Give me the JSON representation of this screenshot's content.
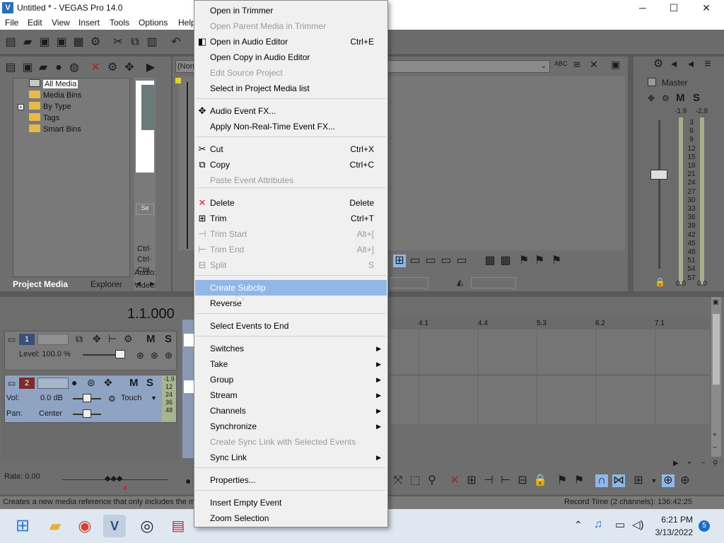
{
  "window": {
    "title": "Untitled * - VEGAS Pro 14.0",
    "min": "─",
    "max": "☐",
    "close": "✕"
  },
  "menu": [
    "File",
    "Edit",
    "View",
    "Insert",
    "Tools",
    "Options",
    "Help"
  ],
  "project_media": {
    "tree": [
      "All Media",
      "Media Bins",
      "By Type",
      "Tags",
      "Smart Bins"
    ],
    "tabs": [
      "Project Media",
      "Explorer"
    ],
    "side_labels": [
      "Ctrl·",
      "Ctrl·",
      "Ctrl·",
      "Video:",
      "Audio:"
    ]
  },
  "trimmer": {
    "preview_combo": "(Non"
  },
  "master": {
    "title": "Master",
    "m": "M",
    "s": "S",
    "db_left": "-1.9",
    "db_right": "-2.8",
    "scale": [
      "3",
      "6",
      "9",
      "12",
      "15",
      "18",
      "21",
      "24",
      "27",
      "30",
      "33",
      "36",
      "39",
      "42",
      "45",
      "48",
      "51",
      "54",
      "57"
    ],
    "bottom_left": "0.0",
    "bottom_right": "0.0"
  },
  "timeline": {
    "time": "1.1.000",
    "ruler": [
      "4.1",
      "4.4",
      "5.3",
      "6.2",
      "7.1"
    ],
    "rate": "Rate: 0.00"
  },
  "tracks": [
    {
      "num": "1",
      "level": "Level: 100.0 %",
      "m": "M",
      "s": "S"
    },
    {
      "num": "2",
      "vol_label": "Vol:",
      "vol_value": "0.0 dB",
      "pan_label": "Pan:",
      "pan_value": "Center",
      "touch": "Touch",
      "m": "M",
      "s": "S",
      "meter": [
        "-1.9",
        "12",
        "24",
        "36",
        "48"
      ]
    }
  ],
  "status": {
    "hint": "Creates a new media reference that only includes the me",
    "record_time": "Record Time (2 channels): 136:42:25"
  },
  "taskbar": {
    "time": "6:21 PM",
    "date": "3/13/2022",
    "badge": "5"
  },
  "context_menu": [
    {
      "label": "Open in Trimmer",
      "shortcut": "",
      "disabled": false
    },
    {
      "label": "Open Parent Media in Trimmer",
      "shortcut": "",
      "disabled": true
    },
    {
      "label": "Open in Audio Editor",
      "shortcut": "Ctrl+E",
      "disabled": false
    },
    {
      "label": "Open Copy in Audio Editor",
      "shortcut": "",
      "disabled": false
    },
    {
      "label": "Edit Source Project",
      "shortcut": "",
      "disabled": true
    },
    {
      "label": "Select in Project Media list",
      "shortcut": "",
      "disabled": false
    },
    {
      "label": "Audio Event FX...",
      "shortcut": "",
      "disabled": false
    },
    {
      "label": "Apply Non-Real-Time Event FX...",
      "shortcut": "",
      "disabled": false
    },
    {
      "label": "Cut",
      "shortcut": "Ctrl+X",
      "disabled": false
    },
    {
      "label": "Copy",
      "shortcut": "Ctrl+C",
      "disabled": false
    },
    {
      "label": "Paste Event Attributes",
      "shortcut": "",
      "disabled": true
    },
    {
      "label": "Delete",
      "shortcut": "Delete",
      "disabled": false
    },
    {
      "label": "Trim",
      "shortcut": "Ctrl+T",
      "disabled": false
    },
    {
      "label": "Trim Start",
      "shortcut": "Alt+[",
      "disabled": true
    },
    {
      "label": "Trim End",
      "shortcut": "Alt+]",
      "disabled": true
    },
    {
      "label": "Split",
      "shortcut": "S",
      "disabled": true
    },
    {
      "label": "Create Subclip",
      "shortcut": "",
      "disabled": false,
      "highlighted": true
    },
    {
      "label": "Reverse",
      "shortcut": "",
      "disabled": false
    },
    {
      "label": "Select Events to End",
      "shortcut": "",
      "disabled": false
    },
    {
      "label": "Switches",
      "shortcut": "",
      "disabled": false,
      "submenu": true
    },
    {
      "label": "Take",
      "shortcut": "",
      "disabled": false,
      "submenu": true
    },
    {
      "label": "Group",
      "shortcut": "",
      "disabled": false,
      "submenu": true
    },
    {
      "label": "Stream",
      "shortcut": "",
      "disabled": false,
      "submenu": true
    },
    {
      "label": "Channels",
      "shortcut": "",
      "disabled": false,
      "submenu": true
    },
    {
      "label": "Synchronize",
      "shortcut": "",
      "disabled": false,
      "submenu": true
    },
    {
      "label": "Create Sync Link with Selected Events",
      "shortcut": "",
      "disabled": true
    },
    {
      "label": "Sync Link",
      "shortcut": "",
      "disabled": false,
      "submenu": true
    },
    {
      "label": "Properties...",
      "shortcut": "",
      "disabled": false
    },
    {
      "label": "Insert Empty Event",
      "shortcut": "",
      "disabled": false
    },
    {
      "label": "Zoom Selection",
      "shortcut": "",
      "disabled": false
    }
  ]
}
